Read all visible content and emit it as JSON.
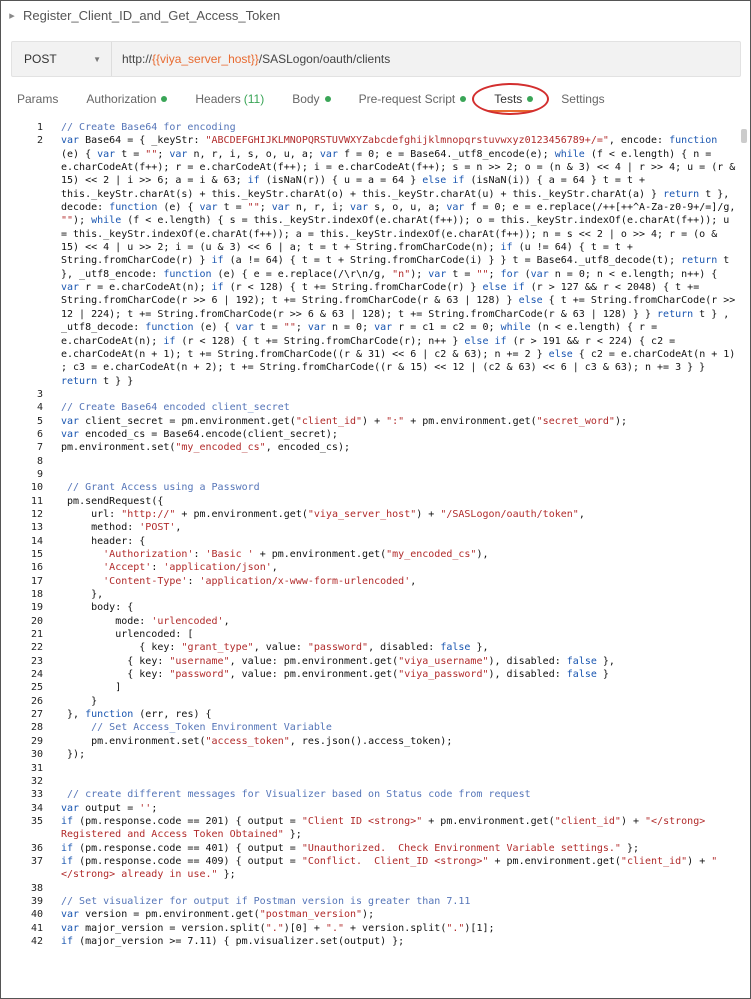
{
  "title": "Register_Client_ID_and_Get_Access_Token",
  "request": {
    "method": "POST",
    "url_prefix": "http://",
    "url_var": "{{viya_server_host}}",
    "url_suffix": "/SASLogon/oauth/clients"
  },
  "tabs": [
    {
      "label": "Params",
      "count": "",
      "dot": false
    },
    {
      "label": "Authorization",
      "count": "",
      "dot": true
    },
    {
      "label": "Headers",
      "count": "(11)",
      "dot": false
    },
    {
      "label": "Body",
      "count": "",
      "dot": true
    },
    {
      "label": "Pre-request Script",
      "count": "",
      "dot": true
    },
    {
      "label": "Tests",
      "count": "",
      "dot": true,
      "active": true
    },
    {
      "label": "Settings",
      "count": "",
      "dot": false
    }
  ],
  "code_lines": [
    {
      "n": "1",
      "t": "// Create Base64 for encoding"
    },
    {
      "n": "2",
      "t": "var Base64 = { _keyStr: \"ABCDEFGHIJKLMNOPQRSTUVWXYZabcdefghijklmnopqrstuvwxyz0123456789+/=\", encode: function (e) { var t = \"\"; var n, r, i, s, o, u, a; var f = 0; e = Base64._utf8_encode(e); while (f < e.length) { n = e.charCodeAt(f++); r = e.charCodeAt(f++); i = e.charCodeAt(f++); s = n >> 2; o = (n & 3) << 4 | r >> 4; u = (r & 15) << 2 | i >> 6; a = i & 63; if (isNaN(r)) { u = a = 64 } else if (isNaN(i)) { a = 64 } t = t + this._keyStr.charAt(s) + this._keyStr.charAt(o) + this._keyStr.charAt(u) + this._keyStr.charAt(a) } return t }, decode: function (e) { var t = \"\"; var n, r, i; var s, o, u, a; var f = 0; e = e.replace(/++[++^A-Za-z0-9+/=]/g, \"\"); while (f < e.length) { s = this._keyStr.indexOf(e.charAt(f++)); o = this._keyStr.indexOf(e.charAt(f++)); u = this._keyStr.indexOf(e.charAt(f++)); a = this._keyStr.indexOf(e.charAt(f++)); n = s << 2 | o >> 4; r = (o & 15) << 4 | u >> 2; i = (u & 3) << 6 | a; t = t + String.fromCharCode(n); if (u != 64) { t = t + String.fromCharCode(r) } if (a != 64) { t = t + String.fromCharCode(i) } } t = Base64._utf8_decode(t); return t }, _utf8_encode: function (e) { e = e.replace(/\\r\\n/g, \"n\"); var t = \"\"; for (var n = 0; n < e.length; n++) { var r = e.charCodeAt(n); if (r < 128) { t += String.fromCharCode(r) } else if (r > 127 && r < 2048) { t += String.fromCharCode(r >> 6 | 192); t += String.fromCharCode(r & 63 | 128) } else { t += String.fromCharCode(r >> 12 | 224); t += String.fromCharCode(r >> 6 & 63 | 128); t += String.fromCharCode(r & 63 | 128) } } return t } , _utf8_decode: function (e) { var t = \"\"; var n = 0; var r = c1 = c2 = 0; while (n < e.length) { r = e.charCodeAt(n); if (r < 128) { t += String.fromCharCode(r); n++ } else if (r > 191 && r < 224) { c2 = e.charCodeAt(n + 1); t += String.fromCharCode((r & 31) << 6 | c2 & 63); n += 2 } else { c2 = e.charCodeAt(n + 1) ; c3 = e.charCodeAt(n + 2); t += String.fromCharCode((r & 15) << 12 | (c2 & 63) << 6 | c3 & 63); n += 3 } } return t } }"
    },
    {
      "n": "3",
      "t": ""
    },
    {
      "n": "4",
      "t": "// Create Base64 encoded client_secret"
    },
    {
      "n": "5",
      "t": "var client_secret = pm.environment.get(\"client_id\") + \":\" + pm.environment.get(\"secret_word\");"
    },
    {
      "n": "6",
      "t": "var encoded_cs = Base64.encode(client_secret);"
    },
    {
      "n": "7",
      "t": "pm.environment.set(\"my_encoded_cs\", encoded_cs);"
    },
    {
      "n": "8",
      "t": ""
    },
    {
      "n": "9",
      "t": ""
    },
    {
      "n": "10",
      "t": " // Grant Access using a Password"
    },
    {
      "n": "11",
      "t": " pm.sendRequest({"
    },
    {
      "n": "12",
      "t": "     url: \"http://\" + pm.environment.get(\"viya_server_host\") + \"/SASLogon/oauth/token\","
    },
    {
      "n": "13",
      "t": "     method: 'POST',"
    },
    {
      "n": "14",
      "t": "     header: {"
    },
    {
      "n": "15",
      "t": "       'Authorization': 'Basic ' + pm.environment.get(\"my_encoded_cs\"),"
    },
    {
      "n": "16",
      "t": "       'Accept': 'application/json',"
    },
    {
      "n": "17",
      "t": "       'Content-Type': 'application/x-www-form-urlencoded',"
    },
    {
      "n": "18",
      "t": "     },"
    },
    {
      "n": "19",
      "t": "     body: {"
    },
    {
      "n": "20",
      "t": "         mode: 'urlencoded',"
    },
    {
      "n": "21",
      "t": "         urlencoded: ["
    },
    {
      "n": "22",
      "t": "             { key: \"grant_type\", value: \"password\", disabled: false },"
    },
    {
      "n": "23",
      "t": "           { key: \"username\", value: pm.environment.get(\"viya_username\"), disabled: false },"
    },
    {
      "n": "24",
      "t": "           { key: \"password\", value: pm.environment.get(\"viya_password\"), disabled: false }"
    },
    {
      "n": "25",
      "t": "         ]"
    },
    {
      "n": "26",
      "t": "     }"
    },
    {
      "n": "27",
      "t": " }, function (err, res) {"
    },
    {
      "n": "28",
      "t": "     // Set Access_Token Environment Variable"
    },
    {
      "n": "29",
      "t": "     pm.environment.set(\"access_token\", res.json().access_token);"
    },
    {
      "n": "30",
      "t": " });"
    },
    {
      "n": "31",
      "t": ""
    },
    {
      "n": "32",
      "t": ""
    },
    {
      "n": "33",
      "t": " // create different messages for Visualizer based on Status code from request"
    },
    {
      "n": "34",
      "t": "var output = '';"
    },
    {
      "n": "35",
      "t": "if (pm.response.code == 201) { output = \"Client ID <strong>\" + pm.environment.get(\"client_id\") + \"</strong> Registered and Access Token Obtained\" };"
    },
    {
      "n": "36",
      "t": "if (pm.response.code == 401) { output = \"Unauthorized.  Check Environment Variable settings.\" };"
    },
    {
      "n": "37",
      "t": "if (pm.response.code == 409) { output = \"Conflict.  Client_ID <strong>\" + pm.environment.get(\"client_id\") + \"</strong> already in use.\" };"
    },
    {
      "n": "38",
      "t": ""
    },
    {
      "n": "39",
      "t": "// Set visualizer for output if Postman version is greater than 7.11"
    },
    {
      "n": "40",
      "t": "var version = pm.environment.get(\"postman_version\");"
    },
    {
      "n": "41",
      "t": "var major_version = version.split(\".\")[0] + \".\" + version.split(\".\")[1];"
    },
    {
      "n": "42",
      "t": "if (major_version >= 7.11) { pm.visualizer.set(output) };"
    }
  ]
}
